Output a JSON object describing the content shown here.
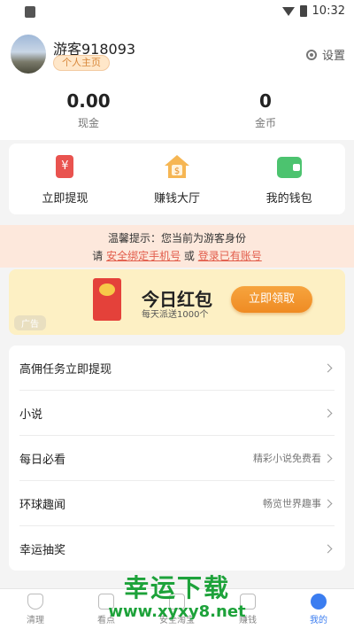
{
  "status_bar": {
    "time": "10:32"
  },
  "profile": {
    "username": "游客918093",
    "home_badge": "个人主页",
    "settings_label": "设置"
  },
  "stats": [
    {
      "value": "0.00",
      "label": "现金"
    },
    {
      "value": "0",
      "label": "金币"
    }
  ],
  "quick_actions": [
    {
      "label": "立即提现",
      "icon": "withdraw-icon",
      "glyph": "¥"
    },
    {
      "label": "赚钱大厅",
      "icon": "house-coin-icon",
      "glyph": "$"
    },
    {
      "label": "我的钱包",
      "icon": "wallet-icon"
    }
  ],
  "notice": {
    "line1": "温馨提示：您当前为游客身份",
    "prefix": "请",
    "bind_phone": "安全绑定手机号",
    "or": "或",
    "login": "登录已有账号"
  },
  "banner": {
    "title": "今日红包",
    "subtitle": "每天派送1000个",
    "button": "立即领取",
    "ad_tag": "广告"
  },
  "menu": [
    {
      "label": "高佣任务立即提现",
      "sub": ""
    },
    {
      "label": "小说",
      "sub": ""
    },
    {
      "label": "每日必看",
      "sub": "精彩小说免费看"
    },
    {
      "label": "环球趣闻",
      "sub": "畅览世界趣事"
    },
    {
      "label": "幸运抽奖",
      "sub": ""
    }
  ],
  "tabs": [
    {
      "label": "清理",
      "icon": "shield-icon",
      "active": false
    },
    {
      "label": "看点",
      "icon": "news-icon",
      "active": false
    },
    {
      "label": "安全淘宝",
      "icon": "shopping-bag-icon",
      "active": false
    },
    {
      "label": "赚钱",
      "icon": "wallet-icon",
      "active": false
    },
    {
      "label": "我的",
      "icon": "profile-icon",
      "active": true
    }
  ],
  "watermark": {
    "title": "幸运下载",
    "url": "www.xyxy8.net"
  },
  "colors": {
    "accent_orange": "#ef8b23",
    "accent_blue": "#3b7df0",
    "link_red": "#e25d4b",
    "watermark_green": "#1da23a"
  }
}
